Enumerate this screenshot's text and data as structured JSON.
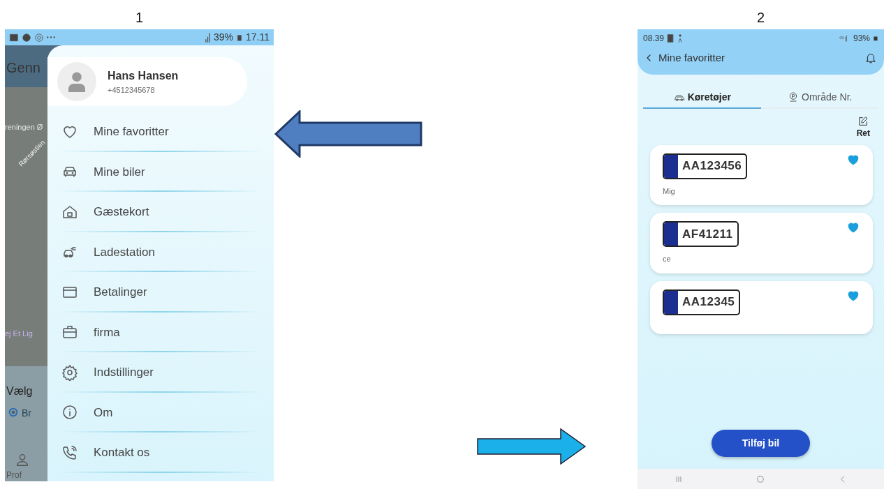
{
  "panel_labels": [
    "1",
    "2"
  ],
  "screen_1": {
    "status_bar": {
      "battery": "39%",
      "time": "17.11"
    },
    "map_labels": [
      "Genn",
      "reningen Ø",
      "Rørsøstien",
      "ej Et Lig",
      "Vælg",
      "Br",
      "Prof"
    ],
    "drawer": {
      "profile": {
        "name": "Hans Hansen",
        "phone": "+4512345678"
      },
      "menu": [
        {
          "label": "Mine favoritter"
        },
        {
          "label": "Mine biler"
        },
        {
          "label": "Gæstekort"
        },
        {
          "label": "Ladestation"
        },
        {
          "label": "Betalinger"
        },
        {
          "label": "firma"
        },
        {
          "label": "Indstillinger"
        },
        {
          "label": "Om"
        },
        {
          "label": "Kontakt os"
        }
      ]
    }
  },
  "arrows": [
    {
      "kind": "left"
    },
    {
      "kind": "right"
    }
  ],
  "screen_2": {
    "status_bar": {
      "time": "08.39",
      "battery": "93%"
    },
    "header": {
      "title": "Mine favoritter"
    },
    "tabs": [
      {
        "label": "Køretøjer",
        "selected": true
      },
      {
        "label": "Område Nr.",
        "selected": false
      }
    ],
    "edit_label": "Ret",
    "vehicles": [
      {
        "plate": "AA123456",
        "note": "Mig",
        "favorite": true
      },
      {
        "plate": "AF41211",
        "note": "ce",
        "favorite": true
      },
      {
        "plate": "AA12345",
        "favorite": true
      }
    ],
    "add_button": "Tilføj bil"
  }
}
